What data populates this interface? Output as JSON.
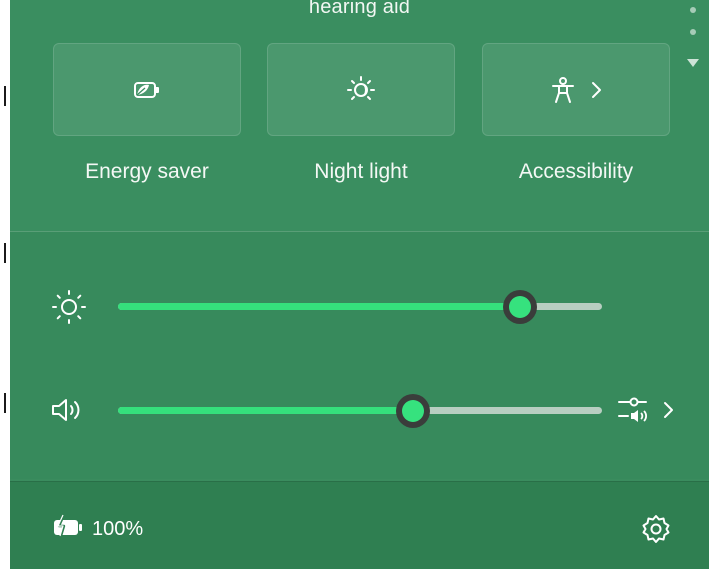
{
  "window": {
    "truncated_label": "hearing aid"
  },
  "quick_settings": {
    "tiles": [
      {
        "label": "Energy saver",
        "icon": "energy-saver-icon",
        "has_chevron": false
      },
      {
        "label": "Night light",
        "icon": "night-light-icon",
        "has_chevron": false
      },
      {
        "label": "Accessibility",
        "icon": "accessibility-icon",
        "has_chevron": true
      }
    ]
  },
  "sliders": {
    "brightness": {
      "icon": "brightness-icon",
      "value_percent": 83
    },
    "volume": {
      "icon": "speaker-icon",
      "value_percent": 61,
      "trailing_icon": "audio-output-icon"
    }
  },
  "footer": {
    "battery_label": "100%",
    "battery_icon": "battery-charging-icon",
    "settings_icon": "gear-icon"
  },
  "colors": {
    "panel_bg": "#3a8c5e",
    "footer_bg": "#2f7f51",
    "accent": "#35e07c",
    "track": "#d6dcd8",
    "text": "#ffffff"
  }
}
